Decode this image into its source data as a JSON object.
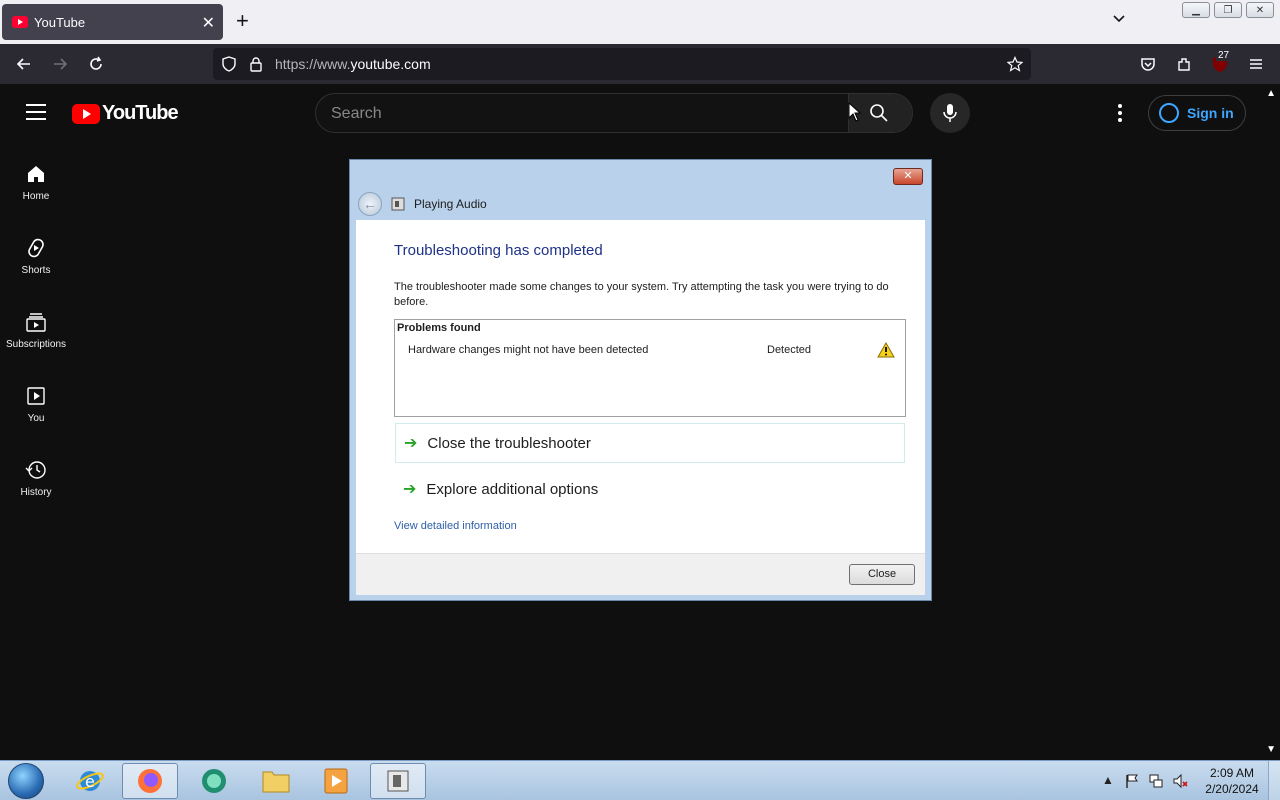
{
  "browser": {
    "tab_title": "YouTube",
    "url_prefix": "https://www.",
    "url_domain": "youtube.com",
    "extension_badge": "27"
  },
  "youtube": {
    "logo_text": "YouTube",
    "search_placeholder": "Search",
    "sign_in": "Sign in",
    "sidebar": [
      {
        "label": "Home"
      },
      {
        "label": "Shorts"
      },
      {
        "label": "Subscriptions"
      },
      {
        "label": "You"
      },
      {
        "label": "History"
      }
    ]
  },
  "dialog": {
    "header_title": "Playing Audio",
    "title": "Troubleshooting has completed",
    "description": "The troubleshooter made some changes to your system. Try attempting the task you were trying to do before.",
    "problems_header": "Problems found",
    "problems": [
      {
        "name": "Hardware changes might not have been detected",
        "status": "Detected"
      }
    ],
    "options": [
      {
        "label": "Close the troubleshooter"
      },
      {
        "label": "Explore additional options"
      }
    ],
    "detail_link": "View detailed information",
    "close_button": "Close"
  },
  "taskbar": {
    "time": "2:09 AM",
    "date": "2/20/2024"
  }
}
